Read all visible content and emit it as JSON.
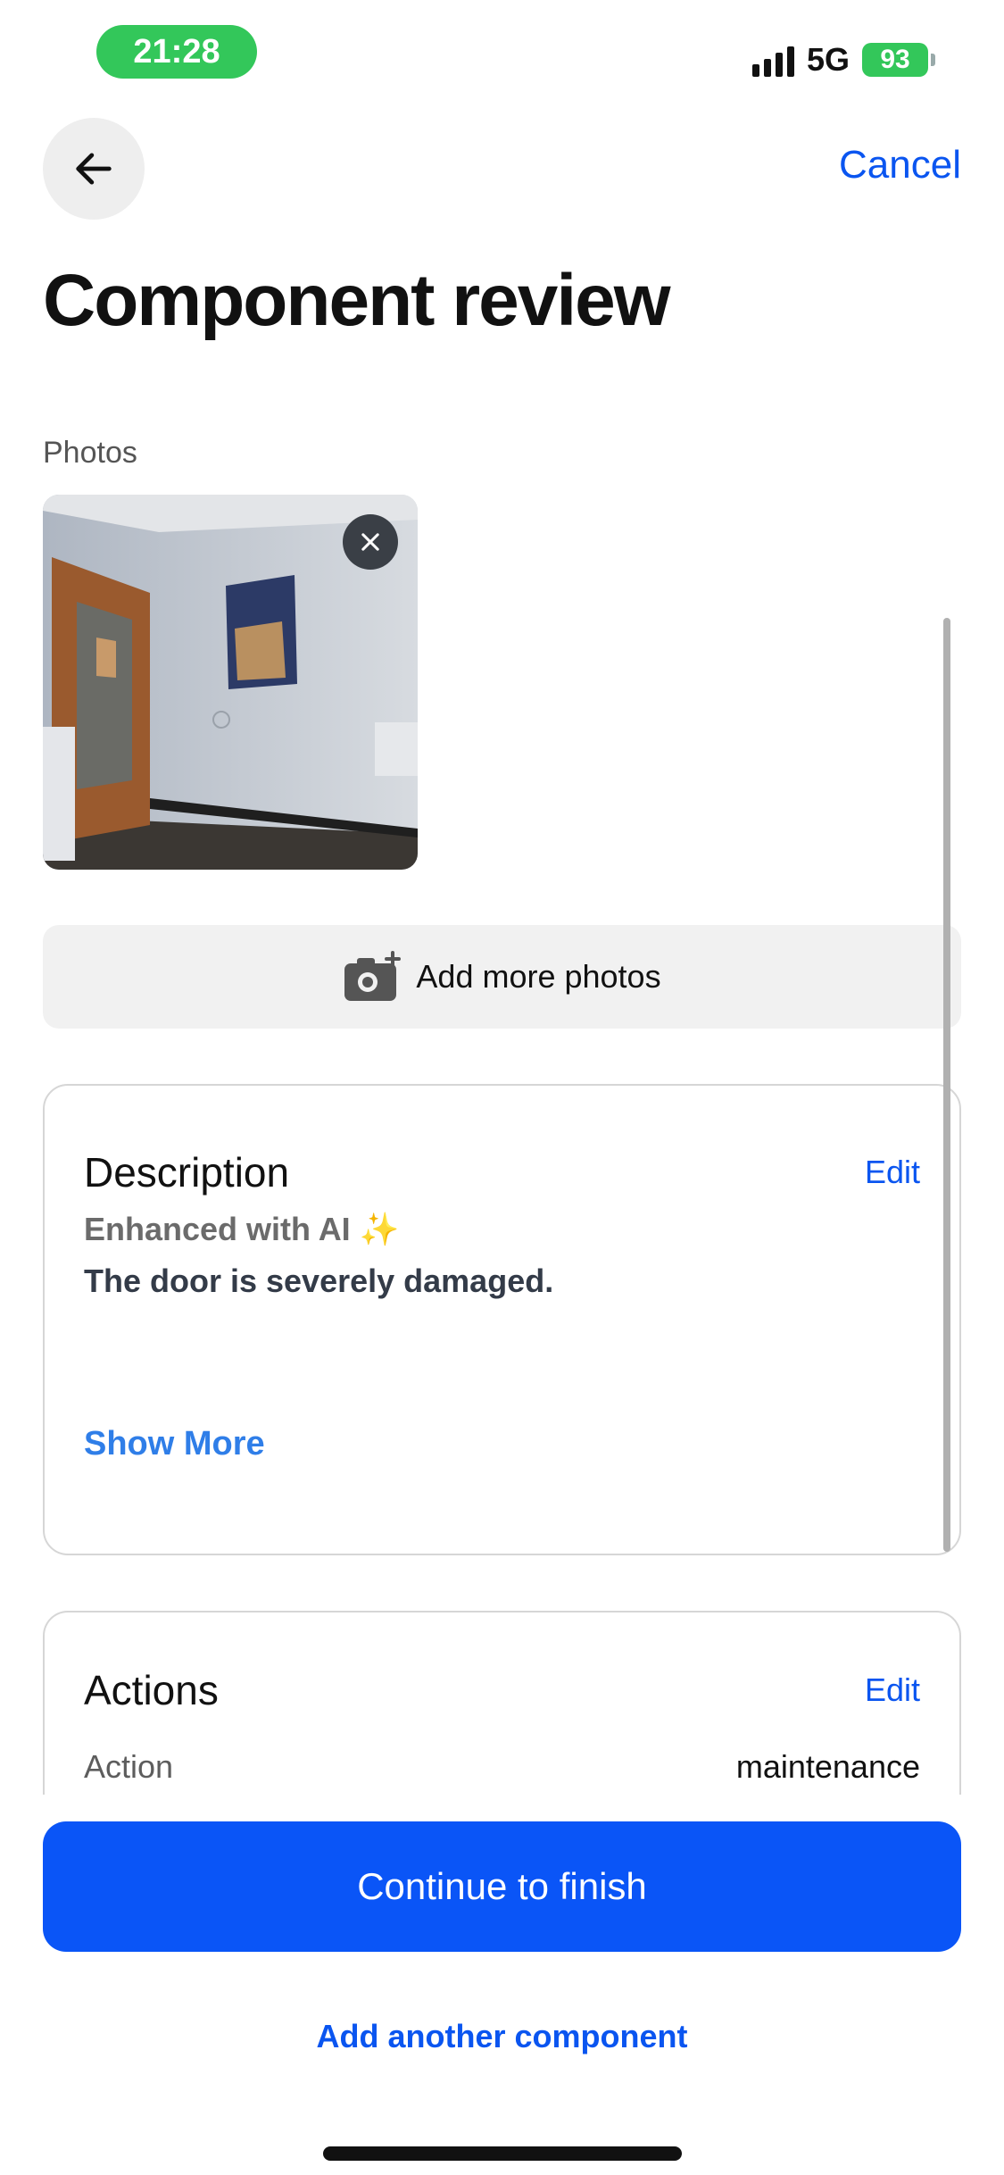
{
  "status_bar": {
    "time": "21:28",
    "network": "5G",
    "battery": "93"
  },
  "header": {
    "back_icon": "arrow-left-icon",
    "cancel_label": "Cancel",
    "title": "Component review"
  },
  "photos": {
    "label": "Photos",
    "remove_icon": "close-icon",
    "add_more_label": "Add more photos",
    "add_icon": "camera-plus-icon"
  },
  "description": {
    "title": "Description",
    "edit_label": "Edit",
    "ai_label": "Enhanced with AI ✨",
    "text": "The door is severely damaged.",
    "show_more_label": "Show More"
  },
  "actions": {
    "title": "Actions",
    "edit_label": "Edit",
    "action_label": "Action",
    "action_value": "maintenance"
  },
  "footer": {
    "primary_label": "Continue to finish",
    "secondary_label": "Add another component"
  },
  "colors": {
    "accent": "#0a55f0",
    "primary_button": "#0a55f7",
    "status_green": "#33c75a"
  }
}
